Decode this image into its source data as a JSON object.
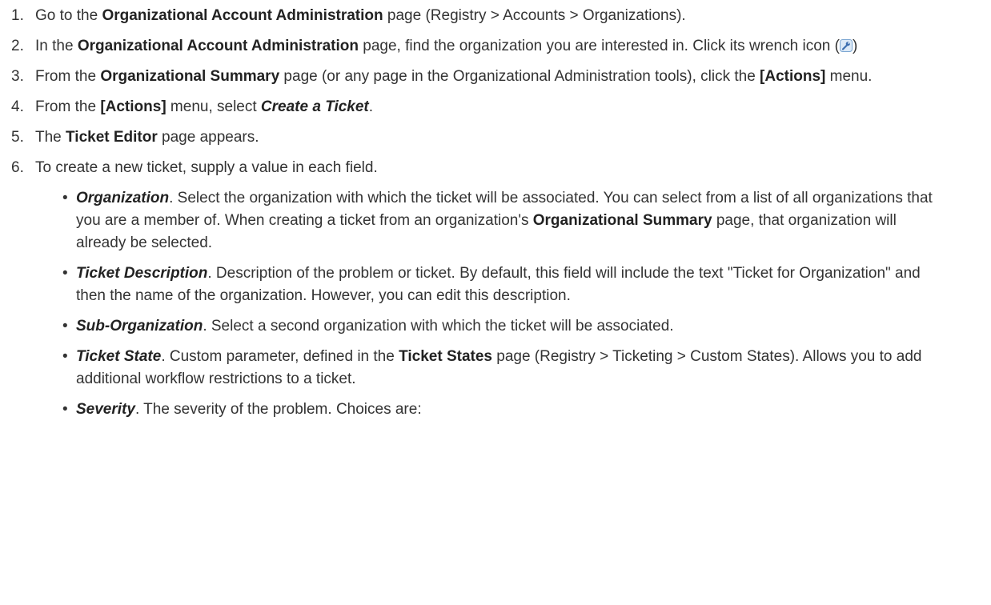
{
  "steps": [
    {
      "num": "1.",
      "parts": [
        {
          "t": "Go to the "
        },
        {
          "t": "Organizational Account Administration",
          "s": "b"
        },
        {
          "t": " page (Registry > Accounts > Organizations)."
        }
      ]
    },
    {
      "num": "2.",
      "parts": [
        {
          "t": "In the "
        },
        {
          "t": "Organizational Account Administration",
          "s": "b"
        },
        {
          "t": " page, find the organization you are interested in. Click its wrench icon ("
        },
        {
          "icon": "wrench-icon"
        },
        {
          "t": ")"
        }
      ]
    },
    {
      "num": "3.",
      "parts": [
        {
          "t": "From the "
        },
        {
          "t": "Organizational Summary",
          "s": "b"
        },
        {
          "t": " page (or any page in the Organizational Administration tools), click the "
        },
        {
          "t": "[Actions]",
          "s": "b"
        },
        {
          "t": " menu."
        }
      ]
    },
    {
      "num": "4.",
      "parts": [
        {
          "t": "From the "
        },
        {
          "t": "[Actions]",
          "s": "b"
        },
        {
          "t": " menu, select "
        },
        {
          "t": "Create a Ticket",
          "s": "bi"
        },
        {
          "t": "."
        }
      ]
    },
    {
      "num": "5.",
      "parts": [
        {
          "t": "The "
        },
        {
          "t": "Ticket Editor",
          "s": "b"
        },
        {
          "t": " page appears."
        }
      ]
    },
    {
      "num": "6.",
      "parts": [
        {
          "t": "To create a new ticket, supply a value in each field."
        }
      ]
    }
  ],
  "fields": [
    {
      "bullet": "•",
      "parts": [
        {
          "t": "Organization",
          "s": "bi"
        },
        {
          "t": ". Select the organization with which the ticket will be associated. You can select from a list of all organizations that you are a member of. When creating a ticket from an organization's "
        },
        {
          "t": "Organizational Summary",
          "s": "b"
        },
        {
          "t": " page, that organization will already be selected."
        }
      ]
    },
    {
      "bullet": "•",
      "parts": [
        {
          "t": "Ticket Description",
          "s": "bi"
        },
        {
          "t": ". Description of the problem or ticket. By default, this field will include the text \"Ticket for Organization\" and then the name of the organization. However, you can edit this description."
        }
      ]
    },
    {
      "bullet": "•",
      "parts": [
        {
          "t": "Sub-Organization",
          "s": "bi"
        },
        {
          "t": ". Select a second organization with which the ticket will be associated."
        }
      ]
    },
    {
      "bullet": "•",
      "parts": [
        {
          "t": "Ticket State",
          "s": "bi"
        },
        {
          "t": ". Custom parameter, defined in the "
        },
        {
          "t": "Ticket States",
          "s": "b"
        },
        {
          "t": " page (Registry > Ticketing > Custom States). Allows you to add additional workflow restrictions to a ticket."
        }
      ]
    },
    {
      "bullet": "•",
      "parts": [
        {
          "t": "Severity",
          "s": "bi"
        },
        {
          "t": ". The severity of the problem. Choices are:"
        }
      ]
    }
  ]
}
